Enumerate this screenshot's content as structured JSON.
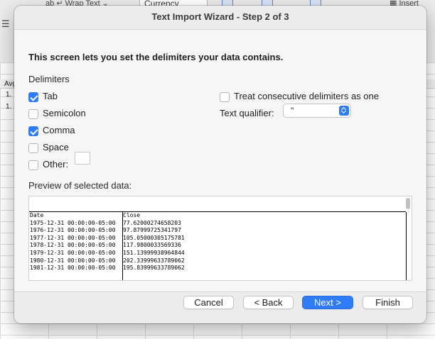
{
  "background": {
    "ribbon": {
      "wrap_text_label": "Wrap Text",
      "number_format": "Currency",
      "insert_label": "Insert"
    },
    "cells": [
      "Avg",
      "1.",
      "1."
    ]
  },
  "dialog": {
    "title": "Text Import Wizard - Step 2 of 3",
    "intro": "This screen lets you set the delimiters your data contains.",
    "delimiters_label": "Delimiters",
    "delimiters": [
      {
        "label": "Tab",
        "checked": true
      },
      {
        "label": "Semicolon",
        "checked": false
      },
      {
        "label": "Comma",
        "checked": true
      },
      {
        "label": "Space",
        "checked": false
      },
      {
        "label": "Other:",
        "checked": false
      }
    ],
    "consecutive": {
      "label": "Treat consecutive delimiters as one",
      "checked": false
    },
    "text_qualifier": {
      "label": "Text qualifier:",
      "value": "\""
    },
    "preview_label": "Preview of selected data:",
    "preview": {
      "date_col": [
        "Date",
        "1975-12-31 00:00:00-05:00",
        "1976-12-31 00:00:00-05:00",
        "1977-12-31 00:00:00-05:00",
        "1978-12-31 00:00:00-05:00",
        "1979-12-31 00:00:00-05:00",
        "1980-12-31 00:00:00-05:00",
        "1981-12-31 00:00:00-05:00"
      ],
      "close_col": [
        "Close",
        "77.62000274658203",
        "97.87999725341797",
        "105.05000305175781",
        "117.9800033569336",
        "151.13999938964844",
        "202.33999633789062",
        "195.83999633789062"
      ]
    },
    "buttons": {
      "cancel": "Cancel",
      "back": "< Back",
      "next": "Next >",
      "finish": "Finish"
    },
    "accent_color": "#2f7cf6"
  }
}
